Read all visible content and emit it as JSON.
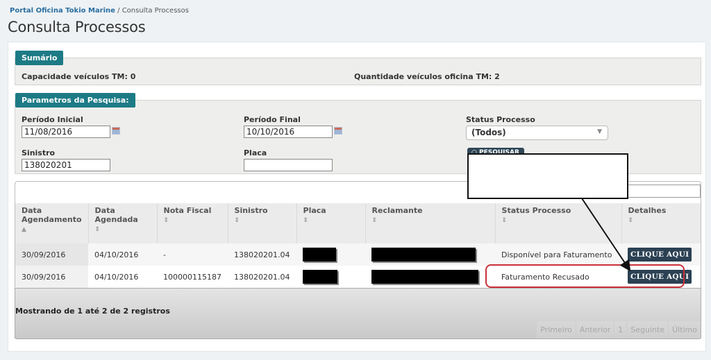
{
  "breadcrumb": {
    "home": "Portal Oficina Tokio Marine",
    "separator": " / ",
    "current": "Consulta Processos"
  },
  "page_title": "Consulta Processos",
  "colors": {
    "legend_bg": "#1d7b86",
    "button_bg": "#2b4153",
    "highlight": "#c9303a",
    "link": "#2a6ea0"
  },
  "sumario": {
    "legend": "Sumário",
    "capacidade_label": "Capacidade veículos TM:",
    "capacidade_value": "0",
    "quantidade_label": "Quantidade veículos oficina TM:",
    "quantidade_value": "2"
  },
  "params": {
    "legend": "Parametros da Pesquisa:",
    "periodo_inicial": {
      "label": "Período Inicial",
      "value": "11/08/2016",
      "icon": "calendar-icon"
    },
    "periodo_final": {
      "label": "Período Final",
      "value": "10/10/2016",
      "icon": "calendar-icon"
    },
    "status": {
      "label": "Status Processo",
      "selected": "(Todos)",
      "icon": "chevron-down-icon"
    },
    "sinistro": {
      "label": "Sinistro",
      "value": "138020201"
    },
    "placa": {
      "label": "Placa",
      "value": ""
    },
    "search_button": "PESQUISAR"
  },
  "table": {
    "search_value": "",
    "columns": [
      {
        "label": "Data Agendamento",
        "sort": "▲"
      },
      {
        "label": "Data Agendada",
        "sort": "⇕"
      },
      {
        "label": "Nota Fiscal",
        "sort": "⇕"
      },
      {
        "label": "Sinistro",
        "sort": "⇕"
      },
      {
        "label": "Placa",
        "sort": "⇕"
      },
      {
        "label": "Reclamante",
        "sort": "⇕"
      },
      {
        "label": "Status Processo",
        "sort": "⇕"
      },
      {
        "label": "Detalhes",
        "sort": "⇕"
      }
    ],
    "rows": [
      {
        "data_agendamento": "30/09/2016",
        "data_agendada": "04/10/2016",
        "nota_fiscal": "-",
        "sinistro": "138020201.04",
        "placa": "[redacted]",
        "reclamante": "[redacted]",
        "status": "Disponível para Faturamento",
        "detalhes": "CLIQUE AQUI"
      },
      {
        "data_agendamento": "30/09/2016",
        "data_agendada": "04/10/2016",
        "nota_fiscal": "100000115187",
        "sinistro": "138020201.04",
        "placa": "[redacted]",
        "reclamante": "[redacted]",
        "status": "Faturamento Recusado",
        "detalhes": "CLIQUE AQUI"
      }
    ],
    "info": "Mostrando de 1 até 2 de 2 registros",
    "pagination": {
      "first": "Primeiro",
      "previous": "Anterior",
      "page": "1",
      "next": "Seguinte",
      "last": "Último"
    }
  },
  "annotation": {
    "callout_text": ""
  }
}
